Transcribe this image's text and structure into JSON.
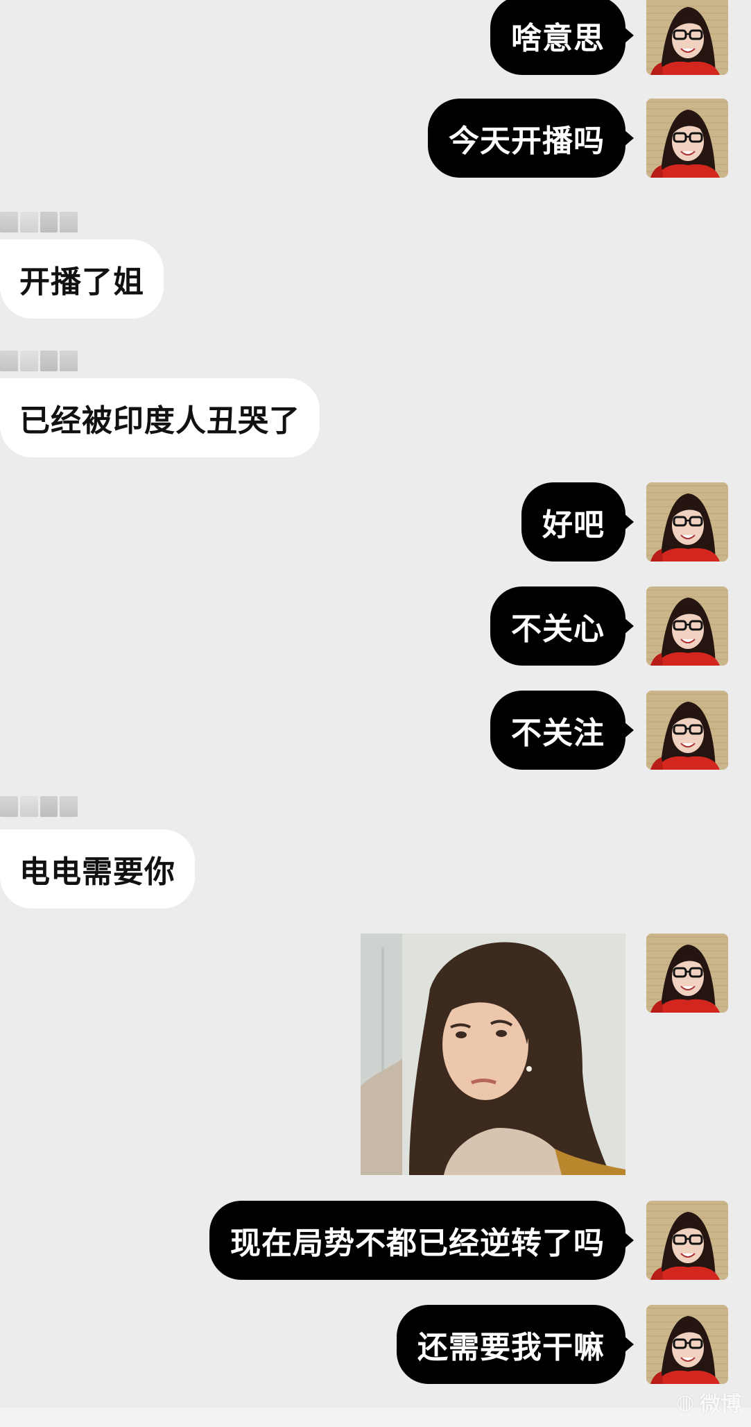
{
  "messages": [
    {
      "type": "out",
      "text": "啥意思"
    },
    {
      "type": "out",
      "text": "今天开播吗"
    },
    {
      "type": "in",
      "text": "开播了姐"
    },
    {
      "type": "in",
      "text": "已经被印度人丑哭了"
    },
    {
      "type": "out",
      "text": "好吧"
    },
    {
      "type": "out",
      "text": "不关心"
    },
    {
      "type": "out",
      "text": "不关注"
    },
    {
      "type": "in",
      "text": "电电需要你"
    },
    {
      "type": "out-image",
      "text": ""
    },
    {
      "type": "out",
      "text": "现在局势不都已经逆转了吗"
    },
    {
      "type": "out",
      "text": "还需要我干嘛"
    }
  ],
  "watermark": {
    "text": "微博"
  },
  "colors": {
    "background": "#ececec",
    "out_bubble": "#000000",
    "in_bubble": "#ffffff",
    "avatar_bg": "#c9b48a",
    "avatar_outfit": "#d3261e"
  },
  "icons": {
    "avatar": "woman-glasses-avatar",
    "sender": "blurred-sender-name"
  }
}
